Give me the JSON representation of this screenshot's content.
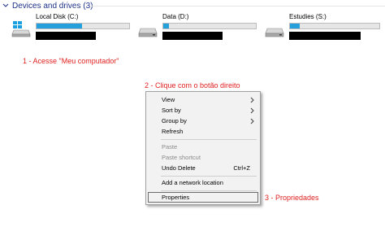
{
  "section": {
    "title": "Devices and drives (3)"
  },
  "drives": [
    {
      "name": "Local Disk (C:)",
      "icon": "windows-drive-icon",
      "used_fraction": 0.49
    },
    {
      "name": "Data (D:)",
      "icon": "drive-icon",
      "used_fraction": 0.06
    },
    {
      "name": "Estudies (S:)",
      "icon": "drive-icon",
      "used_fraction": 0.11
    }
  ],
  "annotations": {
    "step1": "1 - Acesse \"Meu computador\"",
    "step2": "2 - Clique com o botão direito",
    "step3": "3 - Propriedades"
  },
  "context_menu": {
    "view": "View",
    "sort_by": "Sort by",
    "group_by": "Group by",
    "refresh": "Refresh",
    "paste": "Paste",
    "paste_shortcut": "Paste shortcut",
    "undo_delete": "Undo Delete",
    "undo_delete_shortcut": "Ctrl+Z",
    "add_network_location": "Add a network location",
    "properties": "Properties"
  },
  "colors": {
    "accent": "#26a0da",
    "header_text": "#1e3287",
    "annotation": "#e02020"
  }
}
